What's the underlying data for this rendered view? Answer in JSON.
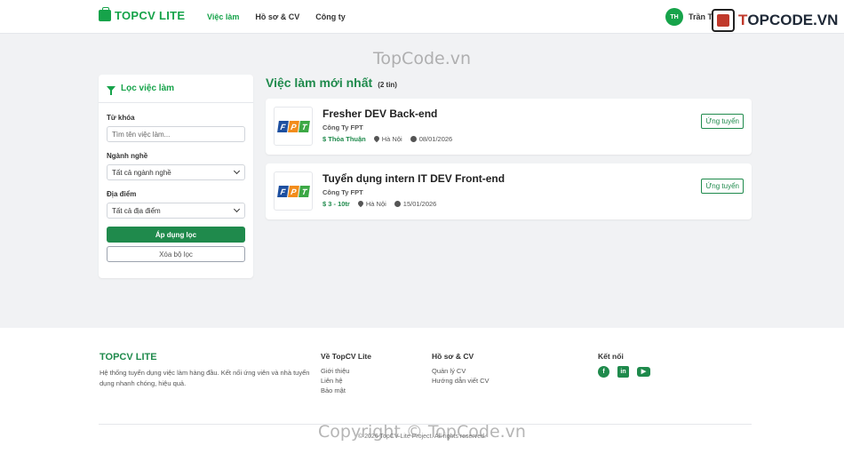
{
  "header": {
    "brand": "TOPCV LITE",
    "nav": [
      {
        "label": "Việc làm",
        "active": true
      },
      {
        "label": "Hồ sơ & CV",
        "active": false
      },
      {
        "label": "Công ty",
        "active": false
      }
    ],
    "user_initials": "TH",
    "user_name": "Trần T..."
  },
  "watermark": {
    "brand_prefix": "T",
    "brand_rest": "OPCODE.VN",
    "center_text": "TopCode.vn",
    "copyright_text": "Copyright © TopCode.vn"
  },
  "filter": {
    "title": "Lọc việc làm",
    "keyword_label": "Từ khóa",
    "keyword_placeholder": "Tìm tên việc làm...",
    "industry_label": "Ngành nghề",
    "industry_value": "Tất cả ngành nghề",
    "location_label": "Địa điểm",
    "location_value": "Tất cả địa điểm",
    "apply_label": "Áp dụng lọc",
    "clear_label": "Xóa bộ lọc"
  },
  "main": {
    "title": "Việc làm mới nhất",
    "count": "(2 tin)",
    "apply_button": "Ứng tuyển",
    "jobs": [
      {
        "title": "Fresher DEV Back-end",
        "company": "Công Ty FPT",
        "salary": "$ Thỏa Thuận",
        "location": "Hà Nội",
        "date": "08/01/2026",
        "logo_letters": [
          "F",
          "P",
          "T"
        ]
      },
      {
        "title": "Tuyển dụng intern IT DEV Front-end",
        "company": "Công Ty FPT",
        "salary": "$ 3 - 10tr",
        "location": "Hà Nội",
        "date": "15/01/2026",
        "logo_letters": [
          "F",
          "P",
          "T"
        ]
      }
    ]
  },
  "footer": {
    "brand": "TOPCV LITE",
    "description": "Hệ thống tuyển dụng việc làm hàng đầu. Kết nối ứng viên và nhà tuyển dụng nhanh chóng, hiệu quả.",
    "about_title": "Về TopCV Lite",
    "about_links": [
      "Giới thiệu",
      "Liên hệ",
      "Bảo mật"
    ],
    "cv_title": "Hồ sơ & CV",
    "cv_links": [
      "Quản lý CV",
      "Hướng dẫn viết CV"
    ],
    "connect_title": "Kết nối",
    "copyright": "© 2026 TopCV Lite Project. All rights reserved."
  },
  "colors": {
    "primary": "#1f8a4c",
    "fpt_blue": "#1d4fa0",
    "fpt_orange": "#f28c1b",
    "fpt_green": "#3ca845"
  }
}
